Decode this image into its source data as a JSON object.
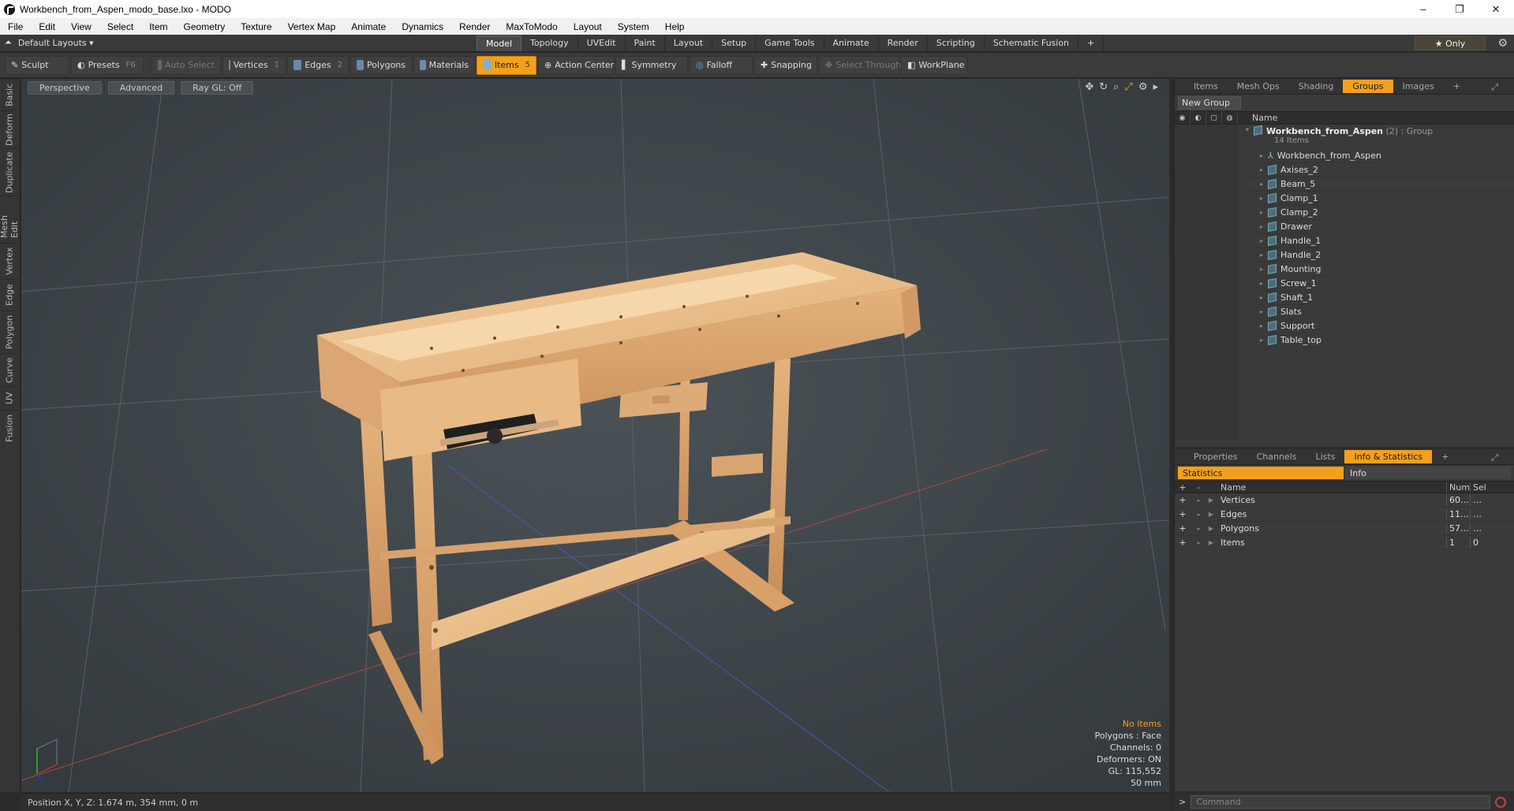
{
  "window": {
    "title": "Workbench_from_Aspen_modo_base.lxo - MODO",
    "minimize": "–",
    "maximize": "❐",
    "close": "✕"
  },
  "menu": [
    "File",
    "Edit",
    "View",
    "Select",
    "Item",
    "Geometry",
    "Texture",
    "Vertex Map",
    "Animate",
    "Dynamics",
    "Render",
    "MaxToModo",
    "Layout",
    "System",
    "Help"
  ],
  "layout_tabs": {
    "layouts_label": "Default Layouts ▾",
    "tabs": [
      "Model",
      "Topology",
      "UVEdit",
      "Paint",
      "Layout",
      "Setup",
      "Game Tools",
      "Animate",
      "Render",
      "Scripting",
      "Schematic Fusion",
      "+"
    ],
    "active": "Model",
    "only_label": "★  Only"
  },
  "toolbar": {
    "sculpt": "Sculpt",
    "presets": "Presets",
    "presets_key": "F6",
    "auto_select": "Auto Select",
    "vertices": "Vertices",
    "vertices_key": "1",
    "edges": "Edges",
    "edges_key": "2",
    "polygons": "Polygons",
    "materials": "Materials",
    "items": "Items",
    "items_key": "5",
    "action_center": "Action Center",
    "symmetry": "Symmetry",
    "falloff": "Falloff",
    "snapping": "Snapping",
    "select_through": "Select Through",
    "workplane": "WorkPlane"
  },
  "left_strip": [
    "Basic",
    "Deform",
    "Duplicate",
    "Mesh Edit",
    "Vertex",
    "Edge",
    "Polygon",
    "Curve",
    "UV",
    "Fusion"
  ],
  "viewport": {
    "view_mode": "Perspective",
    "shading": "Advanced",
    "raygl": "Ray GL: Off",
    "hud": {
      "items": "No Items",
      "polygons": "Polygons : Face",
      "channels": "Channels: 0",
      "deformers": "Deformers: ON",
      "gl": "GL: 115,552",
      "focal": "50 mm"
    }
  },
  "status_bar": "Position X, Y, Z:   1.674 m, 354 mm, 0 m",
  "upper_panel": {
    "tabs": [
      "Items",
      "Mesh Ops",
      "Shading",
      "Groups",
      "Images",
      "+"
    ],
    "active": "Groups",
    "new_group": "New Group",
    "name_col": "Name",
    "group_name": "Workbench_from_Aspen",
    "group_suffix": " (2) : Group",
    "group_count": "14 Items",
    "children": [
      "Workbench_from_Aspen",
      "Axises_2",
      "Beam_5",
      "Clamp_1",
      "Clamp_2",
      "Drawer",
      "Handle_1",
      "Handle_2",
      "Mounting",
      "Screw_1",
      "Shaft_1",
      "Slats",
      "Support",
      "Table_top"
    ]
  },
  "lower_panel": {
    "tabs": [
      "Properties",
      "Channels",
      "Lists",
      "Info & Statistics",
      "+"
    ],
    "active": "Info & Statistics",
    "sub_statistics": "Statistics",
    "sub_info": "Info",
    "columns": {
      "name": "Name",
      "num": "Num",
      "sel": "Sel"
    },
    "rows": [
      {
        "name": "Vertices",
        "num": "60…",
        "sel": "…"
      },
      {
        "name": "Edges",
        "num": "11…",
        "sel": "…"
      },
      {
        "name": "Polygons",
        "num": "57…",
        "sel": "…"
      },
      {
        "name": "Items",
        "num": "1",
        "sel": "0"
      }
    ]
  },
  "command": {
    "prompt": ">",
    "placeholder": "Command"
  },
  "colors": {
    "accent": "#f4a01c",
    "viewport_bg": "#3d4449",
    "wood": "#e8b888"
  }
}
